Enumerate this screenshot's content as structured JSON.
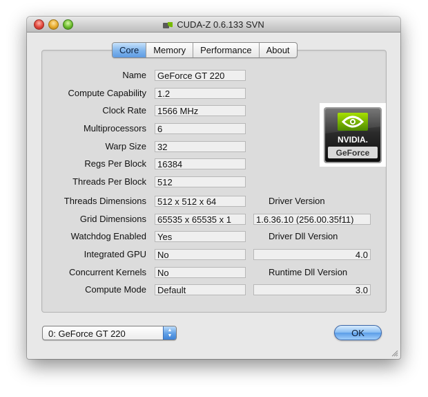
{
  "window": {
    "title": "CUDA-Z 0.6.133 SVN"
  },
  "tabs": [
    {
      "label": "Core",
      "active": true
    },
    {
      "label": "Memory",
      "active": false
    },
    {
      "label": "Performance",
      "active": false
    },
    {
      "label": "About",
      "active": false
    }
  ],
  "core": {
    "name": {
      "label": "Name",
      "value": "GeForce GT 220"
    },
    "compute_capability": {
      "label": "Compute Capability",
      "value": "1.2"
    },
    "clock_rate": {
      "label": "Clock Rate",
      "value": "1566 MHz"
    },
    "multiprocessors": {
      "label": "Multiprocessors",
      "value": "6"
    },
    "warp_size": {
      "label": "Warp Size",
      "value": "32"
    },
    "regs_per_block": {
      "label": "Regs Per Block",
      "value": "16384"
    },
    "threads_per_block": {
      "label": "Threads Per Block",
      "value": "512"
    },
    "threads_dimensions": {
      "label": "Threads Dimensions",
      "value": "512 x 512 x 64"
    },
    "grid_dimensions": {
      "label": "Grid Dimensions",
      "value": "65535 x 65535 x 1"
    },
    "watchdog_enabled": {
      "label": "Watchdog Enabled",
      "value": "Yes"
    },
    "integrated_gpu": {
      "label": "Integrated GPU",
      "value": "No"
    },
    "concurrent_kernels": {
      "label": "Concurrent Kernels",
      "value": "No"
    },
    "compute_mode": {
      "label": "Compute Mode",
      "value": "Default"
    }
  },
  "versions": {
    "driver": {
      "label": "Driver Version",
      "value": "1.6.36.10 (256.00.35f11)"
    },
    "driver_dll": {
      "label": "Driver Dll Version",
      "value": "4.0"
    },
    "runtime_dll": {
      "label": "Runtime Dll Version",
      "value": "3.0"
    }
  },
  "logo": {
    "brand_text": "NVIDIA.",
    "product_text": "GeForce",
    "accent_color": "#76b900"
  },
  "device_selector": {
    "value": "0: GeForce GT 220"
  },
  "ok_button": {
    "label": "OK"
  }
}
